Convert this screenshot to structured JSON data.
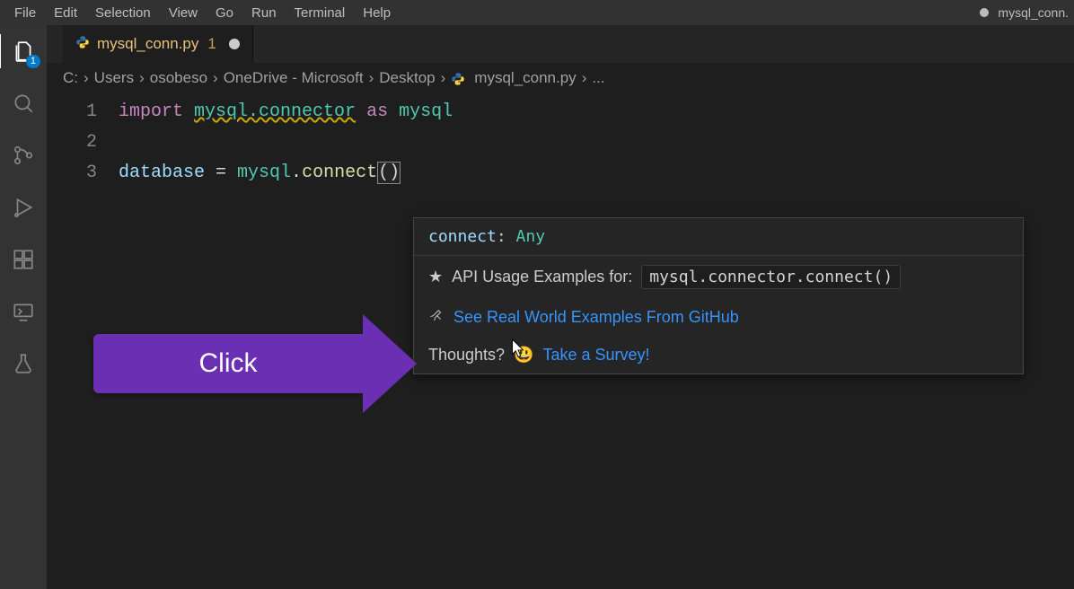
{
  "menubar": {
    "items": [
      "File",
      "Edit",
      "Selection",
      "View",
      "Go",
      "Run",
      "Terminal",
      "Help"
    ],
    "title_right": "mysql_conn."
  },
  "activitybar": {
    "explorer_badge": "1"
  },
  "tab": {
    "filename": "mysql_conn.py",
    "modified_count": "1"
  },
  "breadcrumbs": {
    "segments": [
      "C:",
      "Users",
      "osobeso",
      "OneDrive - Microsoft",
      "Desktop"
    ],
    "file": "mysql_conn.py",
    "tail": "..."
  },
  "editor": {
    "line_numbers": [
      "1",
      "2",
      "3"
    ],
    "line1": {
      "import": "import",
      "module": "mysql.connector",
      "as": "as",
      "alias": "mysql"
    },
    "line3": {
      "var": "database",
      "eq": " = ",
      "obj": "mysql",
      "dot": ".",
      "func": "connect",
      "parens": "()"
    }
  },
  "hover": {
    "sig_name": "connect",
    "sig_colon": ": ",
    "sig_type": "Any",
    "api_label": "API Usage Examples for:",
    "api_token": "mysql.connector.connect()",
    "link_examples": "See Real World Examples From GitHub",
    "thoughts_label": "Thoughts?",
    "survey_link": "Take a Survey!",
    "emoji": "😃",
    "star": "★"
  },
  "annotation": {
    "click_label": "Click"
  }
}
